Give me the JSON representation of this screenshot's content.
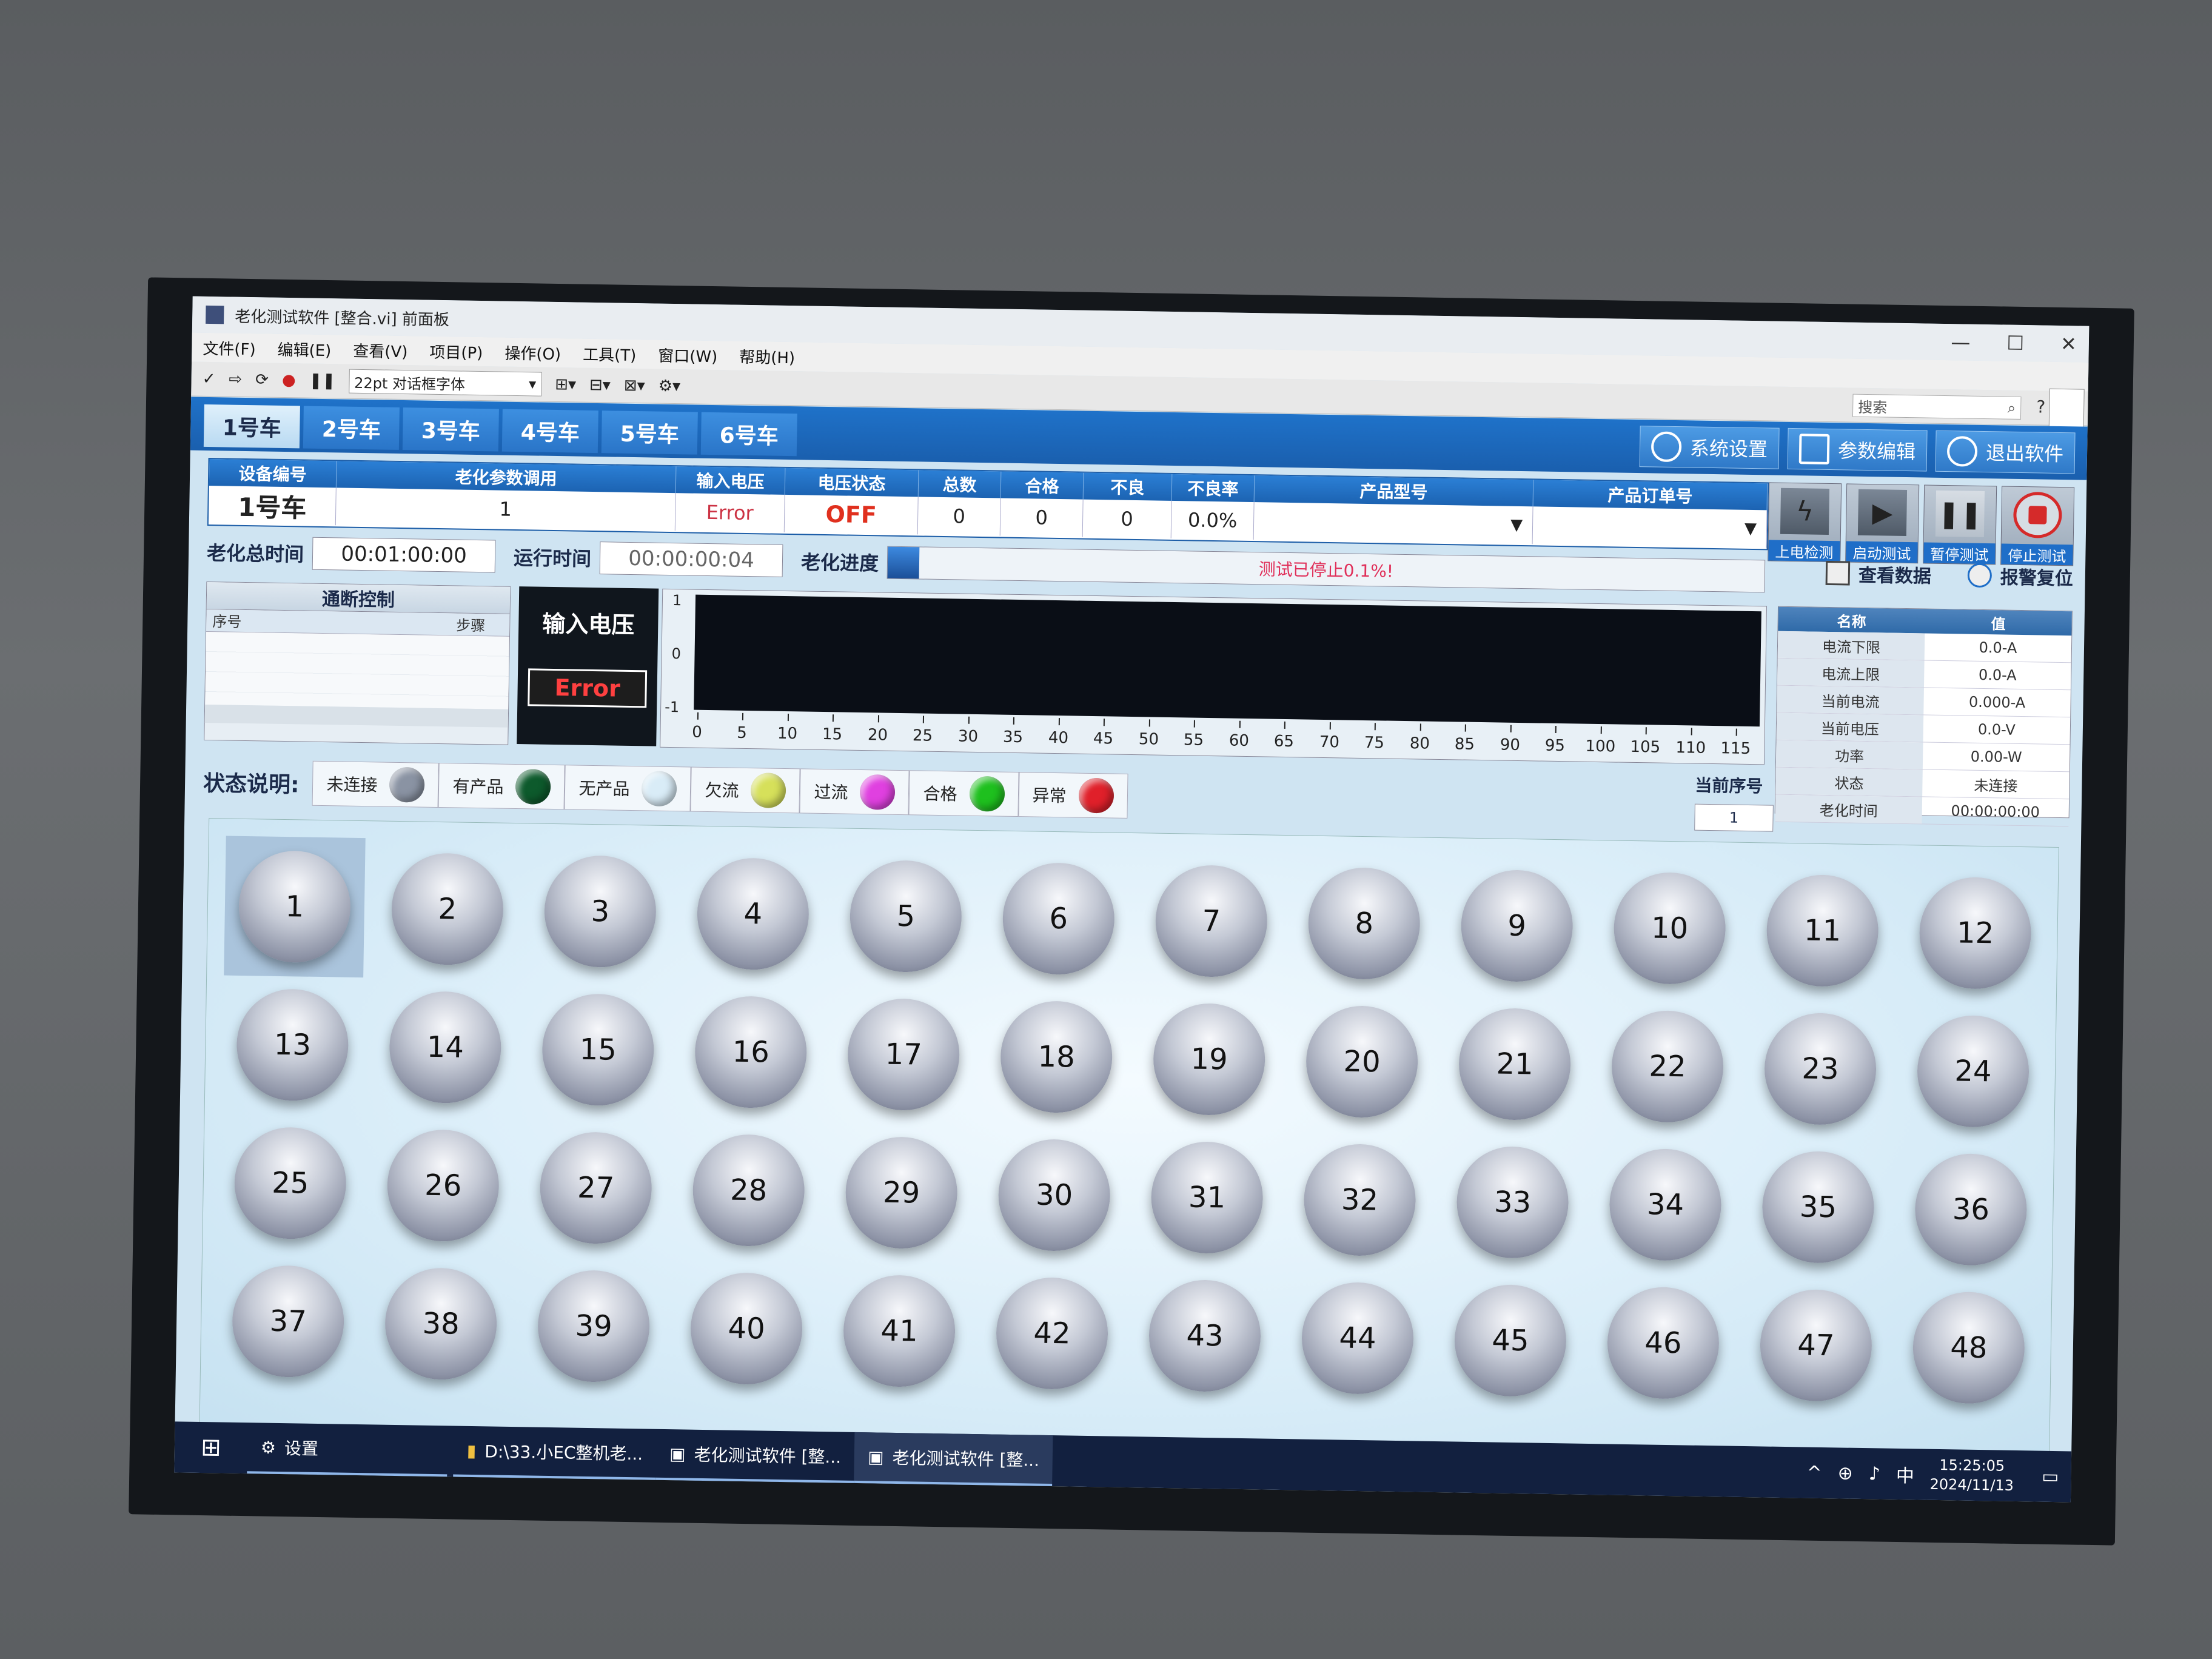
{
  "window": {
    "title": "老化测试软件 [整合.vi] 前面板",
    "minimize": "—",
    "maximize": "☐",
    "close": "✕"
  },
  "menu": [
    "文件(F)",
    "编辑(E)",
    "查看(V)",
    "项目(P)",
    "操作(O)",
    "工具(T)",
    "窗口(W)",
    "帮助(H)"
  ],
  "toolbar": {
    "font": "22pt 对话框字体",
    "search_placeholder": "搜索"
  },
  "tabs": [
    "1号车",
    "2号车",
    "3号车",
    "4号车",
    "5号车",
    "6号车"
  ],
  "top_buttons": [
    "系统设置",
    "参数编辑",
    "退出软件"
  ],
  "info": {
    "headers": [
      "设备编号",
      "老化参数调用",
      "输入电压",
      "电压状态",
      "总数",
      "合格",
      "不良",
      "不良率",
      "产品型号",
      "产品订单号"
    ],
    "values": [
      "1号车",
      "1",
      "Error",
      "OFF",
      "0",
      "0",
      "0",
      "0.0%",
      "",
      ""
    ]
  },
  "control_buttons": [
    "上电检测",
    "启动测试",
    "暂停测试",
    "停止测试"
  ],
  "time": {
    "total_label": "老化总时间",
    "total_value": "00:01:00:00",
    "run_label": "运行时间",
    "run_value": "00:00:00:04",
    "progress_label": "老化进度",
    "progress_fraction": 0.1,
    "progress_text": "测试已停止0.1%!"
  },
  "links": [
    "查看数据",
    "报警复位"
  ],
  "onoff": {
    "title": "通断控制",
    "col_seq": "序号",
    "col_step": "步骤"
  },
  "input_voltage": {
    "title": "输入电压",
    "value": "Error"
  },
  "graph": {
    "y_ticks": [
      "1",
      "0",
      "-1"
    ],
    "x_ticks": [
      "0",
      "5",
      "10",
      "15",
      "20",
      "25",
      "30",
      "35",
      "40",
      "45",
      "50",
      "55",
      "60",
      "65",
      "70",
      "75",
      "80",
      "85",
      "90",
      "95",
      "100",
      "105",
      "110",
      "115"
    ]
  },
  "data_table": {
    "headers": [
      "名称",
      "值"
    ],
    "rows": [
      [
        "电流下限",
        "0.0-A"
      ],
      [
        "电流上限",
        "0.0-A"
      ],
      [
        "当前电流",
        "0.000-A"
      ],
      [
        "当前电压",
        "0.0-V"
      ],
      [
        "功率",
        "0.00-W"
      ],
      [
        "状态",
        "未连接"
      ],
      [
        "老化时间",
        "00:00:00:00"
      ]
    ]
  },
  "current_seq": {
    "label": "当前序号",
    "value": "1"
  },
  "legend": {
    "label": "状态说明:",
    "items": [
      {
        "name": "未连接",
        "color": "#8a93a3"
      },
      {
        "name": "有产品",
        "color": "#0d5a2c"
      },
      {
        "name": "无产品",
        "color": "#d9ecf7"
      },
      {
        "name": "欠流",
        "color": "#d6e05a"
      },
      {
        "name": "过流",
        "color": "#e040e0"
      },
      {
        "name": "合格",
        "color": "#1ec01e"
      },
      {
        "name": "异常",
        "color": "#e0202a"
      }
    ]
  },
  "slots": [
    "1",
    "2",
    "3",
    "4",
    "5",
    "6",
    "7",
    "8",
    "9",
    "10",
    "11",
    "12",
    "13",
    "14",
    "15",
    "16",
    "17",
    "18",
    "19",
    "20",
    "21",
    "22",
    "23",
    "24",
    "25",
    "26",
    "27",
    "28",
    "29",
    "30",
    "31",
    "32",
    "33",
    "34",
    "35",
    "36",
    "37",
    "38",
    "39",
    "40",
    "41",
    "42",
    "43",
    "44",
    "45",
    "46",
    "47",
    "48"
  ],
  "taskbar": {
    "settings": "设置",
    "items": [
      "D:\\33.小EC整机老...",
      "老化测试软件 [整...",
      "老化测试软件 [整..."
    ],
    "ime": "中",
    "time": "15:25:05",
    "date": "2024/11/13"
  }
}
